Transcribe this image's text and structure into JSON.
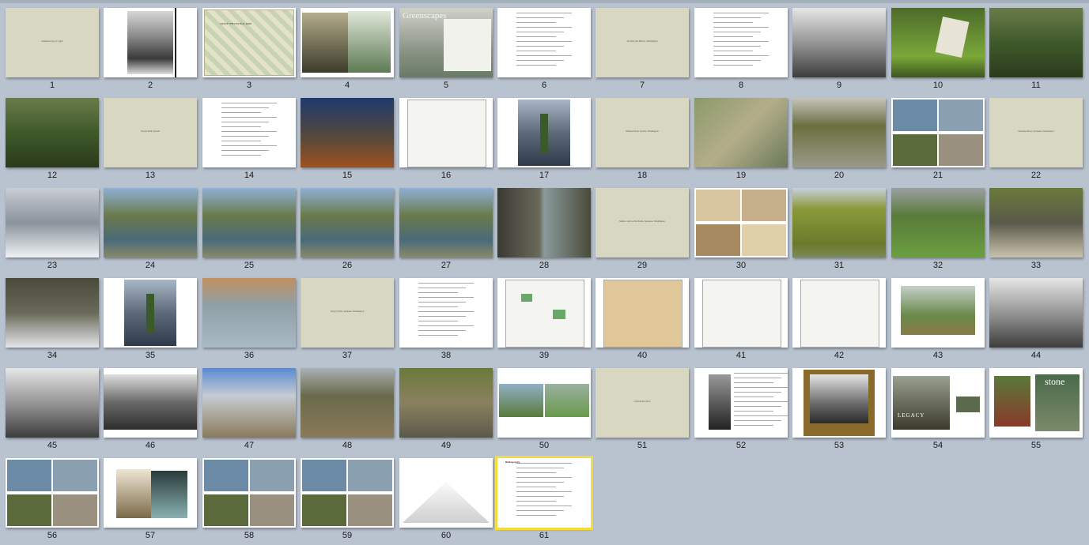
{
  "window": {
    "title": ""
  },
  "selected_slide": 61,
  "slides": [
    {
      "n": "1",
      "kind": "title",
      "text": "Kaleidoscope of Light"
    },
    {
      "n": "2",
      "kind": "portrait",
      "text": ""
    },
    {
      "n": "3",
      "kind": "map",
      "text": "MAP OF THE CENTRAL PARK"
    },
    {
      "n": "4",
      "kind": "collage",
      "text": ""
    },
    {
      "n": "5",
      "kind": "greenscapes",
      "text": "Greenscapes"
    },
    {
      "n": "6",
      "kind": "doc",
      "text": ""
    },
    {
      "n": "7",
      "kind": "title",
      "text": "Tacoma and Burien, Washington"
    },
    {
      "n": "8",
      "kind": "doc",
      "text": ""
    },
    {
      "n": "9",
      "kind": "photo-bw",
      "text": ""
    },
    {
      "n": "10",
      "kind": "photo-green",
      "text": ""
    },
    {
      "n": "11",
      "kind": "photo-forest",
      "text": ""
    },
    {
      "n": "12",
      "kind": "photo-forest",
      "text": ""
    },
    {
      "n": "13",
      "kind": "title",
      "text": "Seattle Park System"
    },
    {
      "n": "14",
      "kind": "doc",
      "text": ""
    },
    {
      "n": "15",
      "kind": "photo-night",
      "text": ""
    },
    {
      "n": "16",
      "kind": "map-bw",
      "text": ""
    },
    {
      "n": "17",
      "kind": "photo-person",
      "text": ""
    },
    {
      "n": "18",
      "kind": "title",
      "text": "Olmsted Park, Seattle, Washington"
    },
    {
      "n": "19",
      "kind": "aerial",
      "text": ""
    },
    {
      "n": "20",
      "kind": "photo-shore",
      "text": ""
    },
    {
      "n": "21",
      "kind": "quad",
      "text": ""
    },
    {
      "n": "22",
      "kind": "title",
      "text": "Spokane River, Spokane, Washington"
    },
    {
      "n": "23",
      "kind": "photo-falls",
      "text": ""
    },
    {
      "n": "24",
      "kind": "photo-river",
      "text": ""
    },
    {
      "n": "25",
      "kind": "photo-river",
      "text": ""
    },
    {
      "n": "26",
      "kind": "photo-river",
      "text": ""
    },
    {
      "n": "27",
      "kind": "photo-river",
      "text": ""
    },
    {
      "n": "28",
      "kind": "photo-rock",
      "text": ""
    },
    {
      "n": "29",
      "kind": "title",
      "text": "Manito and Corbin Parks, Spokane, Washington"
    },
    {
      "n": "30",
      "kind": "quad-sepia",
      "text": ""
    },
    {
      "n": "31",
      "kind": "photo-hedge",
      "text": ""
    },
    {
      "n": "32",
      "kind": "photo-park",
      "text": ""
    },
    {
      "n": "33",
      "kind": "photo-bridge",
      "text": ""
    },
    {
      "n": "34",
      "kind": "photo-snow",
      "text": ""
    },
    {
      "n": "35",
      "kind": "photo-person",
      "text": ""
    },
    {
      "n": "36",
      "kind": "photo-pond",
      "text": ""
    },
    {
      "n": "37",
      "kind": "title",
      "text": "Liberty Park, Spokane, Washington"
    },
    {
      "n": "38",
      "kind": "doc",
      "text": ""
    },
    {
      "n": "39",
      "kind": "map-green",
      "text": ""
    },
    {
      "n": "40",
      "kind": "map-old",
      "text": ""
    },
    {
      "n": "41",
      "kind": "map-bw",
      "text": ""
    },
    {
      "n": "42",
      "kind": "map-bw",
      "text": ""
    },
    {
      "n": "43",
      "kind": "painting",
      "text": ""
    },
    {
      "n": "44",
      "kind": "photo-bw",
      "text": ""
    },
    {
      "n": "45",
      "kind": "photo-bw",
      "text": ""
    },
    {
      "n": "46",
      "kind": "photo-bw2",
      "text": ""
    },
    {
      "n": "47",
      "kind": "photo-bridge2",
      "text": ""
    },
    {
      "n": "48",
      "kind": "photo-ruin",
      "text": ""
    },
    {
      "n": "49",
      "kind": "photo-steps",
      "text": ""
    },
    {
      "n": "50",
      "kind": "pair",
      "text": ""
    },
    {
      "n": "51",
      "kind": "title",
      "text": "Land Restoration"
    },
    {
      "n": "52",
      "kind": "doc-photo",
      "text": ""
    },
    {
      "n": "53",
      "kind": "framed",
      "text": ""
    },
    {
      "n": "54",
      "kind": "book",
      "text": "LEGACY"
    },
    {
      "n": "55",
      "kind": "stone",
      "text": "stone"
    },
    {
      "n": "56",
      "kind": "quad",
      "text": ""
    },
    {
      "n": "57",
      "kind": "books",
      "text": ""
    },
    {
      "n": "58",
      "kind": "quad",
      "text": ""
    },
    {
      "n": "59",
      "kind": "quad",
      "text": ""
    },
    {
      "n": "60",
      "kind": "drawing",
      "text": ""
    },
    {
      "n": "61",
      "kind": "doc",
      "text": "Bibliography"
    }
  ],
  "colors": {
    "background": "#b9c3d0",
    "title_slide": "#d8d7c1",
    "selection": "#f4dc3a"
  }
}
